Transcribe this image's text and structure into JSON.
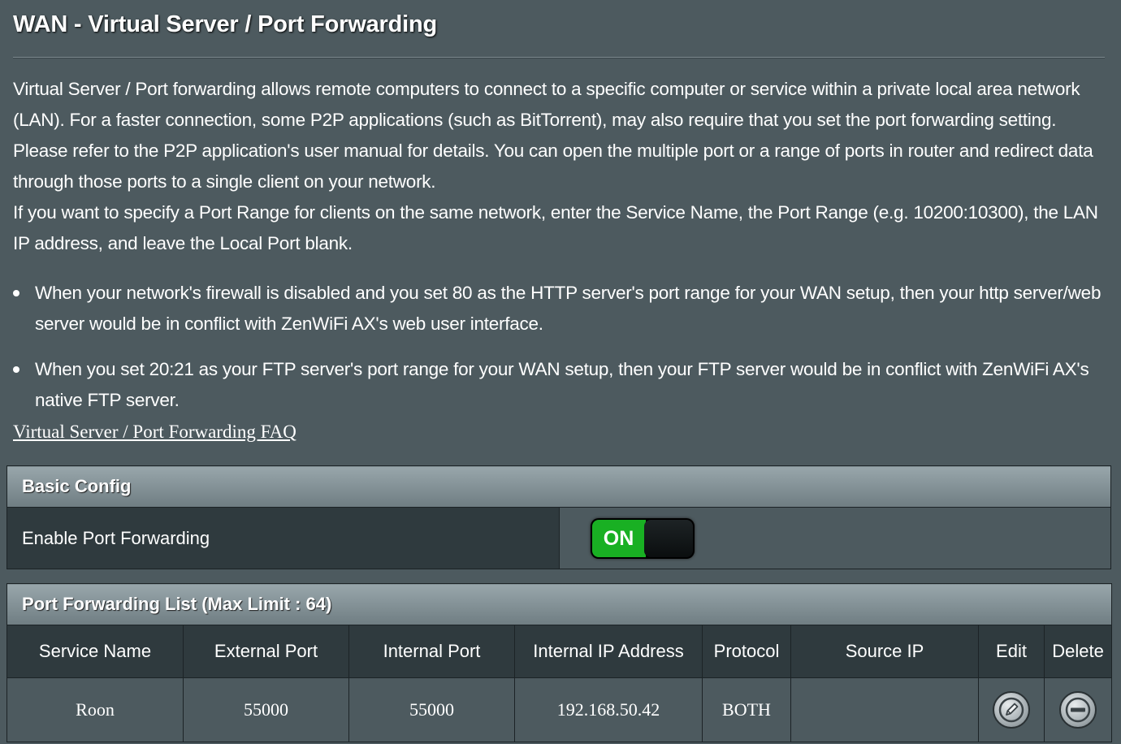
{
  "page": {
    "title": "WAN - Virtual Server / Port Forwarding",
    "description_1": "Virtual Server / Port forwarding allows remote computers to connect to a specific computer or service within a private local area network (LAN). For a faster connection, some P2P applications (such as BitTorrent), may also require that you set the port forwarding setting. Please refer to the P2P application's user manual for details. You can open the multiple port or a range of ports in router and redirect data through those ports to a single client on your network.",
    "description_2": "If you want to specify a Port Range for clients on the same network, enter the Service Name, the Port Range (e.g. 10200:10300), the LAN IP address, and leave the Local Port blank.",
    "bullets": [
      "When your network's firewall is disabled and you set 80 as the HTTP server's port range for your WAN setup, then your http server/web server would be in conflict with ZenWiFi AX's web user interface.",
      "When you set 20:21 as your FTP server's port range for your WAN setup, then your FTP server would be in conflict with ZenWiFi AX's native FTP server."
    ],
    "faq_link": "Virtual Server / Port Forwarding FAQ"
  },
  "basic_config": {
    "header": "Basic Config",
    "enable_label": "Enable Port Forwarding",
    "toggle_state": "ON",
    "toggle_color": "#19b023"
  },
  "port_list": {
    "header": "Port Forwarding List (Max Limit : 64)",
    "columns": [
      "Service Name",
      "External Port",
      "Internal Port",
      "Internal IP Address",
      "Protocol",
      "Source IP",
      "Edit",
      "Delete"
    ],
    "rows": [
      {
        "service_name": "Roon",
        "external_port": "55000",
        "internal_port": "55000",
        "internal_ip": "192.168.50.42",
        "protocol": "BOTH",
        "source_ip": "",
        "edit_icon": "pencil-icon",
        "delete_icon": "minus-circle-icon"
      }
    ]
  }
}
